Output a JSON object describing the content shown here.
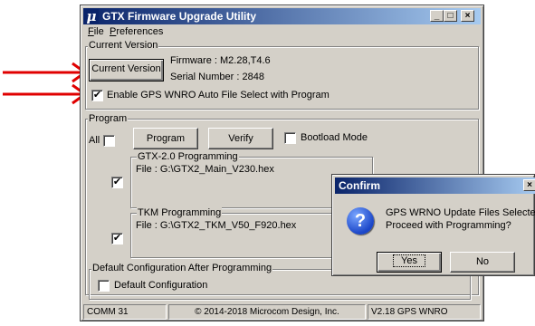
{
  "window": {
    "title": "GTX Firmware Upgrade Utility",
    "icon_glyph": "μ",
    "caption_buttons": {
      "minimize": "_",
      "maximize": "□",
      "close": "×"
    }
  },
  "menu": {
    "items": [
      {
        "label": "File",
        "key": "F",
        "rest": "ile"
      },
      {
        "label": "Preferences",
        "key": "P",
        "rest": "references"
      }
    ]
  },
  "current_version": {
    "legend": "Current Version",
    "button_label": "Current Version",
    "firmware_label": "Firmware : M2.28,T4.6",
    "serial_label": "Serial Number : 2848",
    "auto_select_label": "Enable GPS WNRO Auto File Select with Program",
    "auto_select_checked": "✔"
  },
  "program": {
    "legend": "Program",
    "all_label": "All",
    "all_checked": "",
    "program_button": "Program",
    "verify_button": "Verify",
    "bootload_label": "Bootload Mode",
    "bootload_checked": "",
    "gtx": {
      "legend": "GTX-2.0 Programming",
      "file": "File :  G:\\GTX2_Main_V230.hex",
      "checked": "✔"
    },
    "tkm": {
      "legend": "TKM Programming",
      "file": "File :  G:\\GTX2_TKM_V50_F920.hex",
      "checked": "✔"
    }
  },
  "default_config": {
    "legend": "Default Configuration After Programming",
    "checkbox_label": "Default Configuration",
    "checked": ""
  },
  "status_bar": {
    "port": "COMM 31",
    "copyright": "© 2014-2018 Microcom Design, Inc.",
    "version": "V2.18 GPS WNRO"
  },
  "confirm_dialog": {
    "title": "Confirm",
    "close_glyph": "×",
    "icon_glyph": "?",
    "line1": "GPS WRNO Update Files Selected",
    "line2": "Proceed with Programming?",
    "yes_button": "Yes",
    "no_button": "No"
  },
  "annotations": {
    "arrow_color": "#e00000"
  }
}
